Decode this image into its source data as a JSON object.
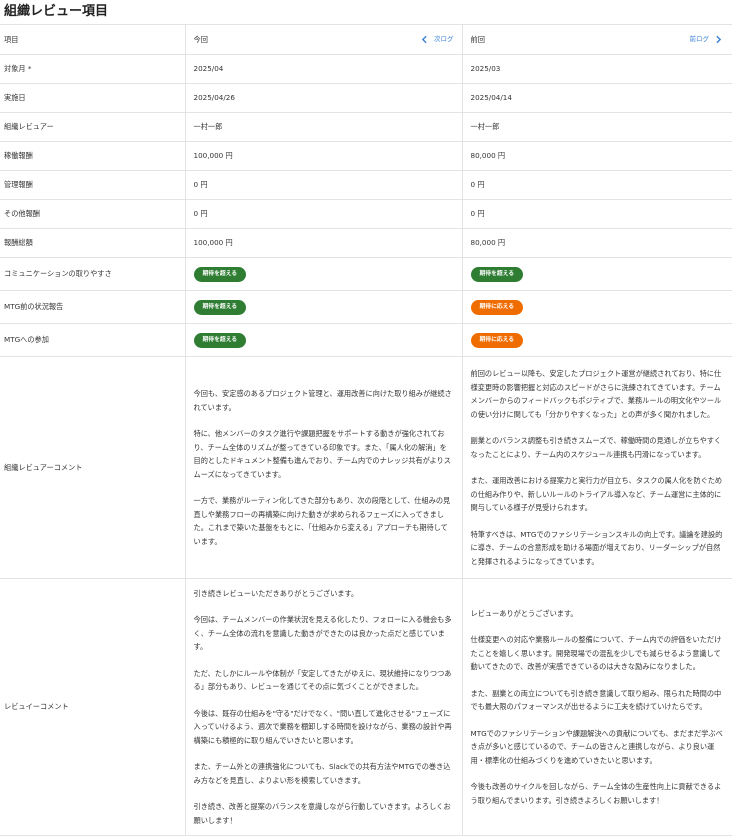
{
  "page_title": "組織レビュー項目",
  "header": {
    "item_label": "項目",
    "current_label": "今回",
    "next_log_label": "次ログ",
    "previous_label": "前回",
    "prev_log_label": "前ログ"
  },
  "rows": [
    {
      "label": "対象月 *",
      "current": "2025/04",
      "previous": "2025/03"
    },
    {
      "label": "実施日",
      "current": "2025/04/26",
      "previous": "2025/04/14"
    },
    {
      "label": "組織レビュアー",
      "current": "一村一郎",
      "previous": "一村一郎"
    },
    {
      "label": "稼働報酬",
      "current": "100,000 円",
      "previous": "80,000 円"
    },
    {
      "label": "管理報酬",
      "current": "0 円",
      "previous": "0 円"
    },
    {
      "label": "その他報酬",
      "current": "0 円",
      "previous": "0 円"
    },
    {
      "label": "報酬総額",
      "current": "100,000 円",
      "previous": "80,000 円"
    }
  ],
  "badge_rows": [
    {
      "label": "コミュニケーションの取りやすさ",
      "current": "期待を超える",
      "previous": "期待を超える",
      "current_color": "#2e7d32",
      "previous_color": "#2e7d32"
    },
    {
      "label": "MTG前の状況報告",
      "current": "期待を超える",
      "previous": "期待に応える",
      "current_color": "#2e7d32",
      "previous_color": "#ef6c00"
    },
    {
      "label": "MTGへの参加",
      "current": "期待を超える",
      "previous": "期待に応える",
      "current_color": "#2e7d32",
      "previous_color": "#ef6c00"
    }
  ],
  "reviewer_comment": {
    "label": "組織レビュアーコメント",
    "current": [
      "今回も、安定感のあるプロジェクト管理と、運用改善に向けた取り組みが継続されています。",
      "特に、他メンバーのタスク進行や課題把握をサポートする動きが強化されており、チーム全体のリズムが整ってきている印象です。また、「属人化の解消」を目的としたドキュメント整備も進んでおり、チーム内でのナレッジ共有がよりスムーズになってきています。",
      "一方で、業務がルーティン化してきた部分もあり、次の段階として、仕組みの見直しや業務フローの再構築に向けた動きが求められるフェーズに入ってきました。これまで築いた基盤をもとに、「仕組みから変える」アプローチも期待しています。"
    ],
    "previous": [
      "前回のレビュー以降も、安定したプロジェクト運営が継続されており、特に仕様変更時の影響把握と対応のスピードがさらに洗練されてきています。チームメンバーからのフィードバックもポジティブで、業務ルールの明文化やツールの使い分けに関しても「分かりやすくなった」との声が多く聞かれました。",
      "副業とのバランス調整も引き続きスムーズで、稼働時間の見通しが立ちやすくなったことにより、チーム内のスケジュール連携も円滑になっています。",
      "また、運用改善における提案力と実行力が目立ち、タスクの属人化を防ぐための仕組み作りや、新しいルールのトライアル導入など、チーム運営に主体的に関与している様子が見受けられます。",
      "特筆すべきは、MTGでのファシリテーションスキルの向上です。議論を建設的に導き、チームの合意形成を助ける場面が増えており、リーダーシップが自然と発揮されるようになってきています。"
    ]
  },
  "reviewee_comment": {
    "label": "レビュイーコメント",
    "current": [
      "引き続きレビューいただきありがとうございます。",
      "今回は、チームメンバーの作業状況を見える化したり、フォローに入る機会も多く、チーム全体の流れを意識した動きができたのは良かった点だと感じています。",
      "ただ、たしかにルールや体制が「安定してきたがゆえに、現状維持になりつつある」部分もあり、レビューを通じてその点に気づくことができました。",
      "今後は、既存の仕組みを\"守る\"だけでなく、\"問い直して進化させる\"フェーズに入っていけるよう、週次で業務を棚卸しする時間を設けながら、業務の設計や再構築にも積極的に取り組んでいきたいと思います。",
      "また、チーム外との連携強化についても、Slackでの共有方法やMTGでの巻き込み方などを見直し、よりよい形を模索していきます。",
      "引き続き、改善と提案のバランスを意識しながら行動していきます。よろしくお願いします！"
    ],
    "previous": [
      "レビューありがとうございます。",
      "仕様変更への対応や業務ルールの整備について、チーム内での評価をいただけたことを嬉しく思います。開発現場での混乱を少しでも減らせるよう意識して動いてきたので、改善が実感できているのは大きな励みになりました。",
      "また、副業との両立についても引き続き意識して取り組み、限られた時間の中でも最大限のパフォーマンスが出せるように工夫を続けていけたらです。",
      "MTGでのファシリテーションや課題解決への貢献についても、まだまだ学ぶべき点が多いと感じているので、チームの皆さんと連携しながら、より良い運用・標準化の仕組みづくりを進めていきたいと思います。",
      "今後も改善のサイクルを回しながら、チーム全体の生産性向上に貢献できるよう取り組んでまいります。引き続きよろしくお願いします！"
    ]
  }
}
